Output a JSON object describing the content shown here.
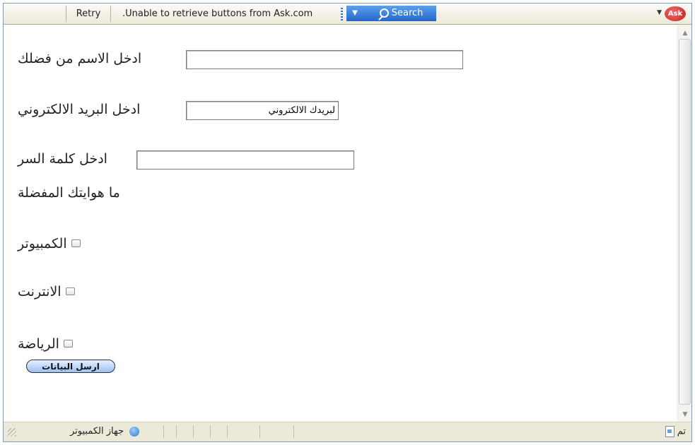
{
  "toolbar": {
    "retry_label": "Retry",
    "message": ".Unable to retrieve buttons from Ask.com",
    "search_label": "Search",
    "logo_text": "Ask"
  },
  "form": {
    "name_label": "ادخل الاسم من فضلك",
    "name_value": "",
    "email_label": "ادخل البريد الالكتروني",
    "email_value": "لبريدك الالكتروني",
    "password_label": "ادخل كلمة السر",
    "password_value": "",
    "hobbies_label": "ما هوايتك المفضلة",
    "hobbies": [
      {
        "label": "الكمبيوتر",
        "checked": false
      },
      {
        "label": "الانترنت",
        "checked": false
      },
      {
        "label": "الرياضة",
        "checked": false
      }
    ],
    "submit_label": "ارسل البيانات"
  },
  "statusbar": {
    "status_text": "تم",
    "zone_text": "جهاز الكمبيوتر"
  },
  "colors": {
    "search_blue": "#2467c8",
    "ask_red": "#c41d1d",
    "chrome_bg": "#ece9d8"
  }
}
